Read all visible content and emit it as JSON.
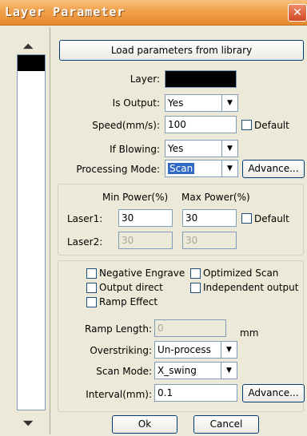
{
  "window": {
    "title": "Layer Parameter",
    "close_glyph": "✕"
  },
  "side": {
    "up_glyph": "⏶",
    "down_glyph": "⏷"
  },
  "top": {
    "load_button": "Load parameters from library"
  },
  "fields": {
    "layer_label": "Layer:",
    "is_output_label": "Is Output:",
    "is_output_value": "Yes",
    "speed_label": "Speed(mm/s):",
    "speed_value": "100",
    "default_label": "Default",
    "if_blowing_label": "If Blowing:",
    "if_blowing_value": "Yes",
    "processing_mode_label": "Processing Mode:",
    "processing_mode_value": "Scan",
    "advance_label": "Advance..."
  },
  "power": {
    "min_header": "Min Power(%)",
    "max_header": "Max Power(%)",
    "laser1_label": "Laser1:",
    "laser1_min": "30",
    "laser1_max": "30",
    "default_label": "Default",
    "laser2_label": "Laser2:",
    "laser2_min": "30",
    "laser2_max": "30"
  },
  "options": {
    "negative_engrave": "Negative Engrave",
    "optimized_scan": "Optimized Scan",
    "output_direct": "Output direct",
    "independent_output": "Independent output",
    "ramp_effect": "Ramp Effect",
    "ramp_length_label": "Ramp Length:",
    "ramp_length_value": "0",
    "ramp_unit": "mm",
    "overstriking_label": "Overstriking:",
    "overstriking_value": "Un-process",
    "scan_mode_label": "Scan Mode:",
    "scan_mode_value": "X_swing",
    "interval_label": "Interval(mm):",
    "interval_value": "0.1",
    "advance_label": "Advance..."
  },
  "footer": {
    "ok_label": "Ok",
    "cancel_label": "Cancel"
  },
  "icons": {
    "dropdown": "chevron-down-icon",
    "close": "close-icon"
  },
  "colors": {
    "titlebar": "#f0a14c",
    "selection": "#316ac5"
  }
}
